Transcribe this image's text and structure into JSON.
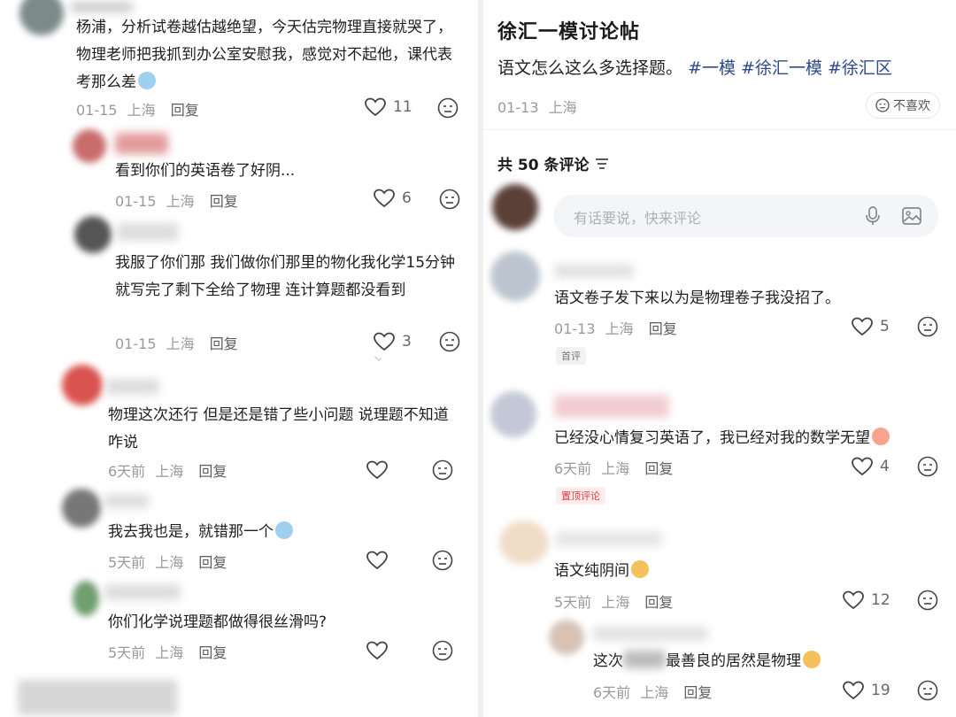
{
  "left": {
    "comments": [
      {
        "text": "杨浦，分析试卷越估越绝望，今天估完物理直接就哭了，物理老师把我抓到办公室安慰我，感觉对不起他，课代表考那么差",
        "date": "01-15",
        "location": "上海",
        "reply": "回复",
        "likes": "11"
      },
      {
        "text": "看到你们的英语卷了好阴...",
        "date": "01-15",
        "location": "上海",
        "reply": "回复",
        "likes": "6"
      },
      {
        "text": "我服了你们那 我们做你们那里的物化我化学15分钟就写完了剩下全给了物理 连计算题都没看到",
        "date": "01-15",
        "location": "上海",
        "reply": "回复",
        "likes": "3"
      },
      {
        "text": "物理这次还行 但是还是错了些小问题 说理题不知道咋说",
        "date": "6天前",
        "location": "上海",
        "reply": "回复",
        "likes": ""
      },
      {
        "text": "我去我也是，就错那一个",
        "date": "5天前",
        "location": "上海",
        "reply": "回复",
        "likes": ""
      },
      {
        "text": "你们化学说理题都做得很丝滑吗?",
        "date": "5天前",
        "location": "上海",
        "reply": "回复",
        "likes": ""
      }
    ]
  },
  "right": {
    "post": {
      "title": "徐汇一模讨论帖",
      "body": "语文怎么这么多选择题。",
      "hashtags": [
        "#一模",
        "#徐汇一模",
        "#徐汇区"
      ],
      "date": "01-13",
      "location": "上海",
      "dislike_label": "不喜欢"
    },
    "comment_count_label": "共 50 条评论",
    "input_placeholder": "有话要说，快来评论",
    "comments": [
      {
        "text": "语文卷子发下来以为是物理卷子我没招了。",
        "date": "01-13",
        "location": "上海",
        "reply": "回复",
        "likes": "5",
        "tag": "首评"
      },
      {
        "text": "已经没心情复习英语了，我已经对我的数学无望",
        "date": "6天前",
        "location": "上海",
        "reply": "回复",
        "likes": "4",
        "tag": "置顶评论"
      },
      {
        "text": "语文纯阴间",
        "date": "5天前",
        "location": "上海",
        "reply": "回复",
        "likes": "12"
      },
      {
        "text_a": "这次",
        "text_b": "最善良的居然是物理",
        "date": "6天前",
        "location": "上海",
        "reply": "回复",
        "likes": "19"
      }
    ]
  }
}
